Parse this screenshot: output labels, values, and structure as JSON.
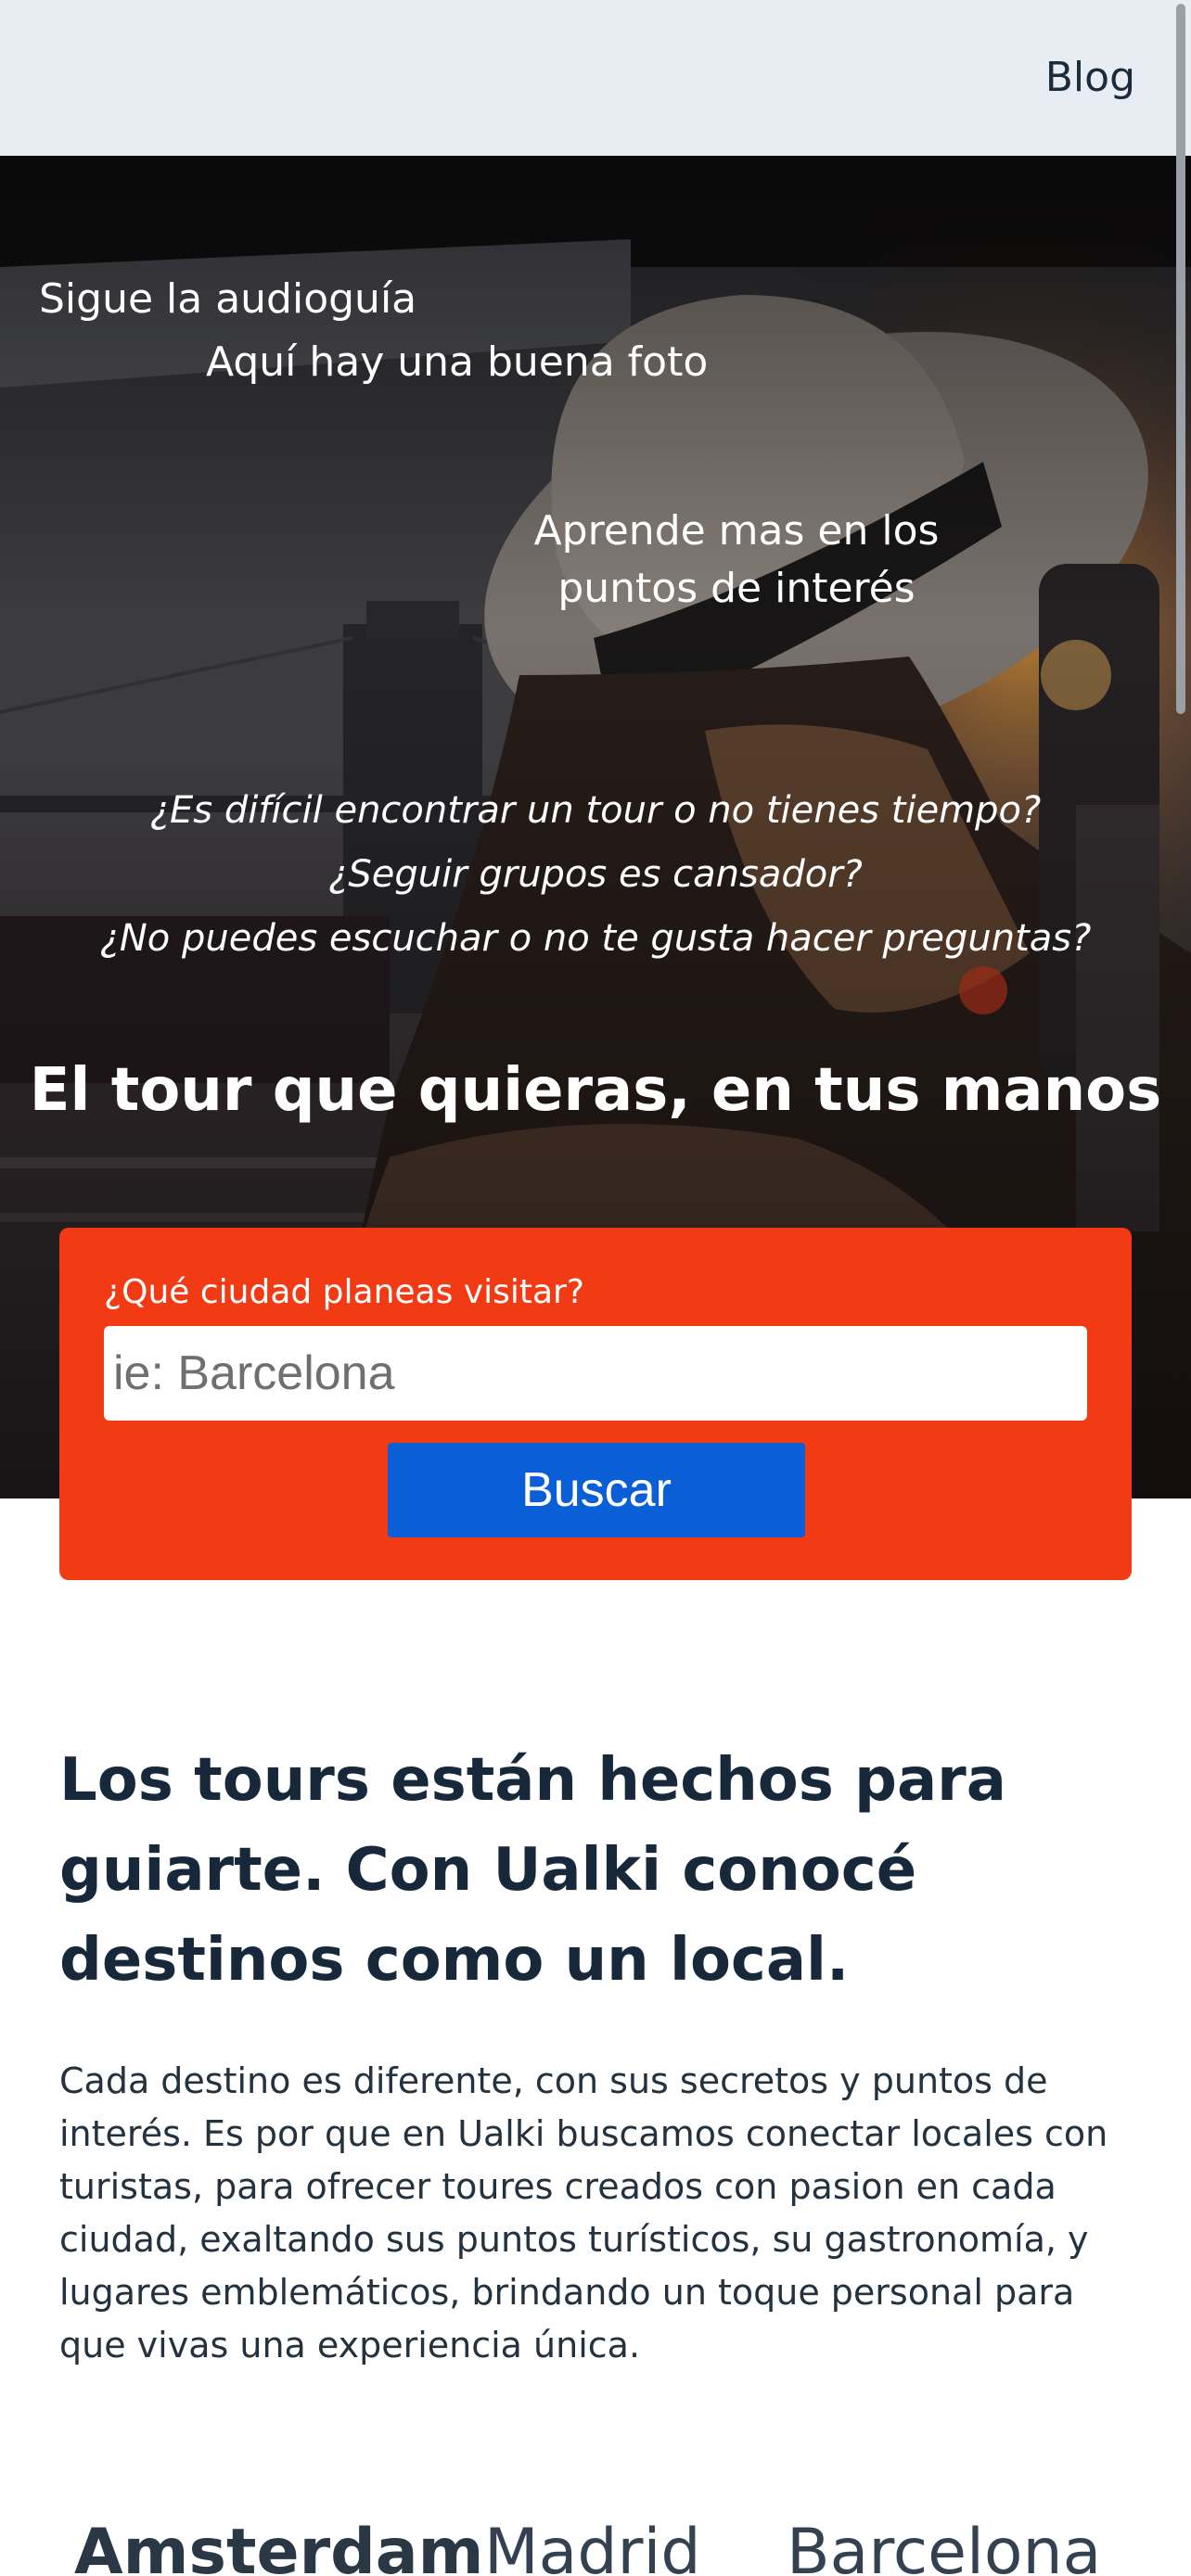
{
  "nav": {
    "blog_label": "Blog"
  },
  "hero": {
    "follow_text": "Sigue la audioguía",
    "photo_text": "Aquí hay una buena foto",
    "learn_text": "Aprende mas en los puntos de interés",
    "questions": [
      "¿Es difícil encontrar un tour o no tienes tiempo?",
      "¿Seguir grupos es cansador?",
      "¿No puedes escuchar o no te gusta hacer preguntas?"
    ],
    "title": "El tour que quieras, en tus manos",
    "image": "woman-with-hat-photo"
  },
  "search": {
    "label": "¿Qué ciudad planeas visitar?",
    "value": "",
    "placeholder": "ie: Barcelona",
    "button_label": "Buscar"
  },
  "about": {
    "title": "Los tours están hechos para guiarte. Con Ualki conocé destinos como un local.",
    "body": "Cada destino es diferente, con sus secretos y puntos de interés. Es por que en Ualki buscamos conectar locales con turistas, para ofrecer toures creados con pasion en cada ciudad, exaltando sus puntos turísticos, su gastronomía, y lugares emblemáticos, brindando un toque personal para que vivas una experiencia única."
  },
  "cities": {
    "items": [
      "Amsterdam",
      "Madrid",
      "Barcelona"
    ],
    "selected": "Amsterdam"
  },
  "colors": {
    "nav_bg": "#e8edf4",
    "search_card": "#f23b14",
    "button": "#0a5fd6",
    "heading": "#16283a"
  }
}
